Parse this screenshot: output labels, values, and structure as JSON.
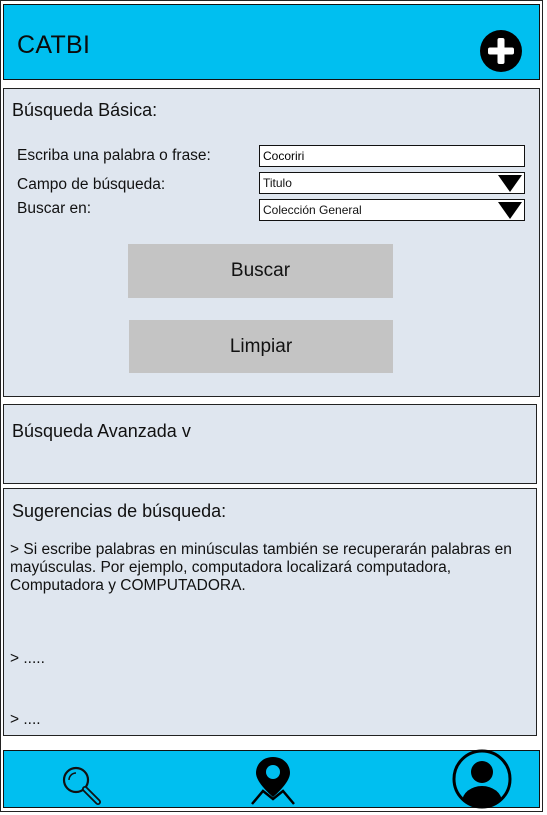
{
  "header": {
    "title": "CATBI",
    "add_icon": "plus-circle-icon"
  },
  "basic_search": {
    "title": "Búsqueda Básica:",
    "phrase_label": "Escriba una palabra o frase:",
    "phrase_value": "Cocoriri",
    "field_label": "Campo de búsqueda:",
    "field_value": "Titulo",
    "scope_label": "Buscar en:",
    "scope_value": "Colección General",
    "search_button": "Buscar",
    "clear_button": "Limpiar"
  },
  "advanced_search": {
    "title": "Búsqueda Avanzada  v"
  },
  "suggestions": {
    "title": "Sugerencias de búsqueda:",
    "items": [
      "> Si escribe palabras en minúsculas también se recuperarán palabras en     mayúsculas. Por ejemplo, computadora localizará computadora, Computadora y COMPUTADORA.",
      "> .....",
      "> ...."
    ]
  },
  "bottom_nav": {
    "icons": [
      "search-icon",
      "location-pin-icon",
      "user-profile-icon"
    ]
  },
  "colors": {
    "accent": "#00bff0",
    "panel": "#dfe6ef",
    "button": "#c4c4c4"
  }
}
